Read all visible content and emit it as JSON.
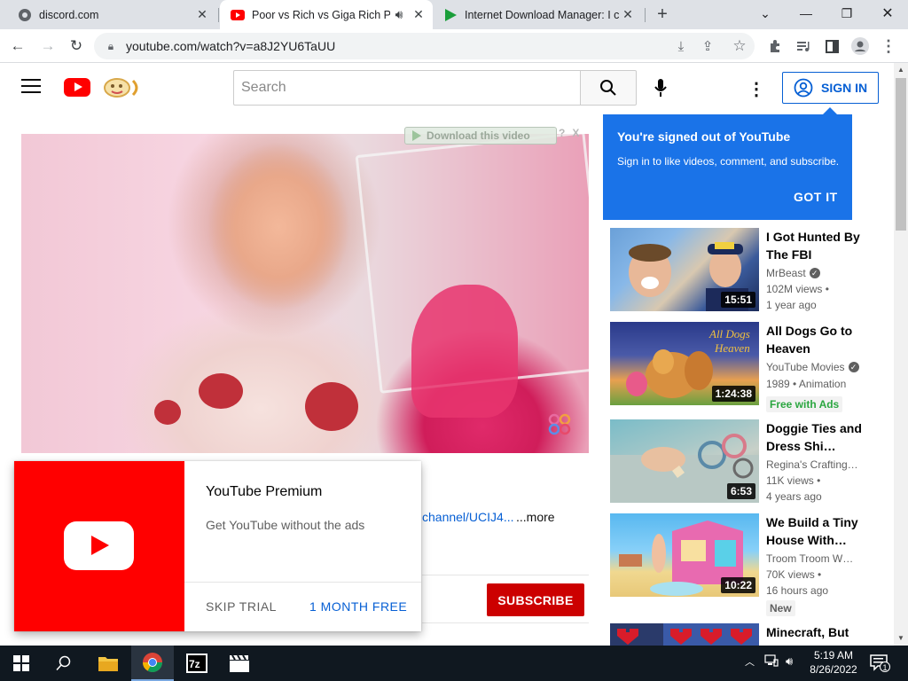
{
  "browser": {
    "tabs": [
      {
        "title": "discord.com",
        "active": false
      },
      {
        "title": "Poor vs Rich vs Giga Rich Pre",
        "active": true
      },
      {
        "title": "Internet Download Manager: I ca",
        "active": false
      }
    ],
    "url": "youtube.com/watch?v=a8J2YU6TaUU"
  },
  "youtube": {
    "search_placeholder": "Search",
    "sign_in": "SIGN IN"
  },
  "player": {
    "idm_download": "Download this video",
    "idm_help": "?",
    "idm_close": "X"
  },
  "description": {
    "link": "channel/UCIJ4...",
    "more": "...more",
    "subscribe": "SUBSCRIBE"
  },
  "promo": {
    "title": "YouTube Premium",
    "subtitle": "Get YouTube without the ads",
    "skip": "SKIP TRIAL",
    "free": "1 MONTH FREE"
  },
  "tooltip": {
    "title": "You're signed out of YouTube",
    "body": "Sign in to like videos, comment, and subscribe.",
    "button": "GOT IT"
  },
  "recommendations": [
    {
      "title": "I Got Hunted By The FBI",
      "channel": "MrBeast",
      "verified": true,
      "views": "102M views •",
      "age": "1 year ago",
      "duration": "15:51",
      "badge": ""
    },
    {
      "title": "All Dogs Go to Heaven",
      "channel": "YouTube Movies",
      "verified": true,
      "views": "1989 • Animation",
      "age": "",
      "duration": "1:24:38",
      "badge": "Free with Ads"
    },
    {
      "title": "Doggie Ties and Dress Shi…",
      "channel": "Regina's Crafting…",
      "verified": false,
      "views": "11K views •",
      "age": "4 years ago",
      "duration": "6:53",
      "badge": ""
    },
    {
      "title": "We Build a Tiny House With…",
      "channel": "Troom Troom W…",
      "verified": false,
      "views": "70K views •",
      "age": "16 hours ago",
      "duration": "10:22",
      "badge": "New"
    },
    {
      "title": "Minecraft, But",
      "channel": "",
      "verified": false,
      "views": "",
      "age": "",
      "duration": "",
      "badge": ""
    }
  ],
  "taskbar": {
    "time": "5:19 AM",
    "date": "8/26/2022",
    "notifications": "1"
  },
  "colors": {
    "youtube_red": "#ff0000",
    "subscribe_red": "#cc0000",
    "link_blue": "#065fd4",
    "tooltip_blue": "#1a73e8"
  }
}
